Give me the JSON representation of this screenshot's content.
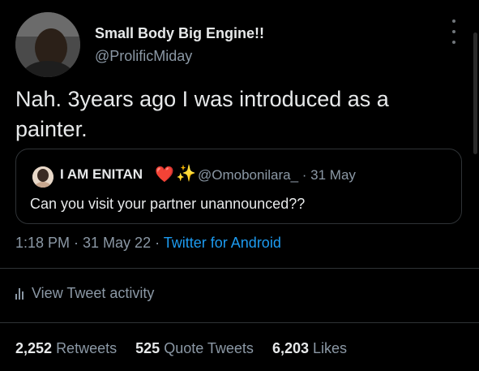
{
  "author": {
    "name": "Small Body Big Engine!!",
    "handle": "@ProlificMiday"
  },
  "tweet": {
    "text": "Nah. 3years ago I was introduced as a painter."
  },
  "quoted_tweet": {
    "name": "I AM ENITAN",
    "heart_emoji": "❤️",
    "sparkle_emoji": "✨",
    "handle_date": "@Omobonilara_ · 31 May",
    "text": "Can you visit your partner unannounced??"
  },
  "meta": {
    "time_date": "1:18 PM · 31 May 22 · ",
    "source": "Twitter for Android"
  },
  "activity": {
    "label": "View Tweet activity",
    "icon": "analytics-bars-icon"
  },
  "stats": {
    "retweets_count": "2,252",
    "retweets_label": "Retweets",
    "quotes_count": "525",
    "quotes_label": "Quote Tweets",
    "likes_count": "6,203",
    "likes_label": "Likes"
  },
  "colors": {
    "background": "#000000",
    "text": "#e7e9ea",
    "secondary": "#8b98a5",
    "link": "#1d9bf0",
    "border": "#2f3336"
  }
}
